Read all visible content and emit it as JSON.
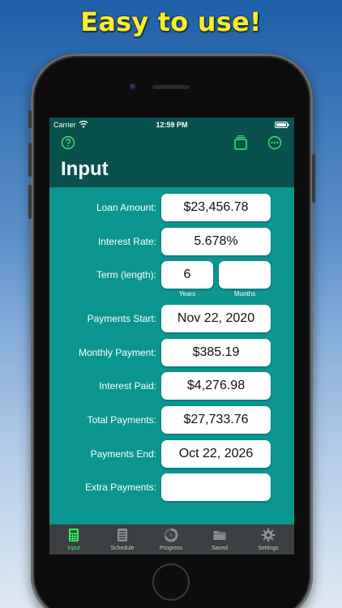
{
  "promo": {
    "headline": "Easy to use!"
  },
  "status_bar": {
    "carrier": "Carrier",
    "time": "12:59 PM"
  },
  "header": {
    "title": "Input"
  },
  "form": {
    "loan_amount": {
      "label": "Loan Amount:",
      "value": "$23,456.78"
    },
    "interest_rate": {
      "label": "Interest Rate:",
      "value": "5.678%"
    },
    "term": {
      "label": "Term (length):",
      "years_value": "6",
      "months_value": "",
      "years_label": "Years",
      "months_label": "Months"
    },
    "payments_start": {
      "label": "Payments Start:",
      "value": "Nov 22, 2020"
    },
    "monthly_payment": {
      "label": "Monthly Payment:",
      "value": "$385.19"
    },
    "interest_paid": {
      "label": "Interest Paid:",
      "value": "$4,276.98"
    },
    "total_payments": {
      "label": "Total Payments:",
      "value": "$27,733.76"
    },
    "payments_end": {
      "label": "Payments End:",
      "value": "Oct 22, 2026"
    },
    "extra_payments": {
      "label": "Extra Payments:",
      "value": ""
    }
  },
  "tabs": [
    {
      "label": "Input",
      "icon": "calculator-icon",
      "active": true
    },
    {
      "label": "Schedule",
      "icon": "schedule-list-icon",
      "active": false
    },
    {
      "label": "Progress",
      "icon": "progress-ring-icon",
      "active": false
    },
    {
      "label": "Saved",
      "icon": "folder-icon",
      "active": false
    },
    {
      "label": "Settings",
      "icon": "gear-icon",
      "active": false
    }
  ],
  "colors": {
    "bar_dark_teal": "#08514e",
    "content_teal": "#0a9590",
    "accent_green": "#3de86a",
    "tabbar_gray": "#3b3f41",
    "headline_yellow": "#f7ee2a"
  }
}
